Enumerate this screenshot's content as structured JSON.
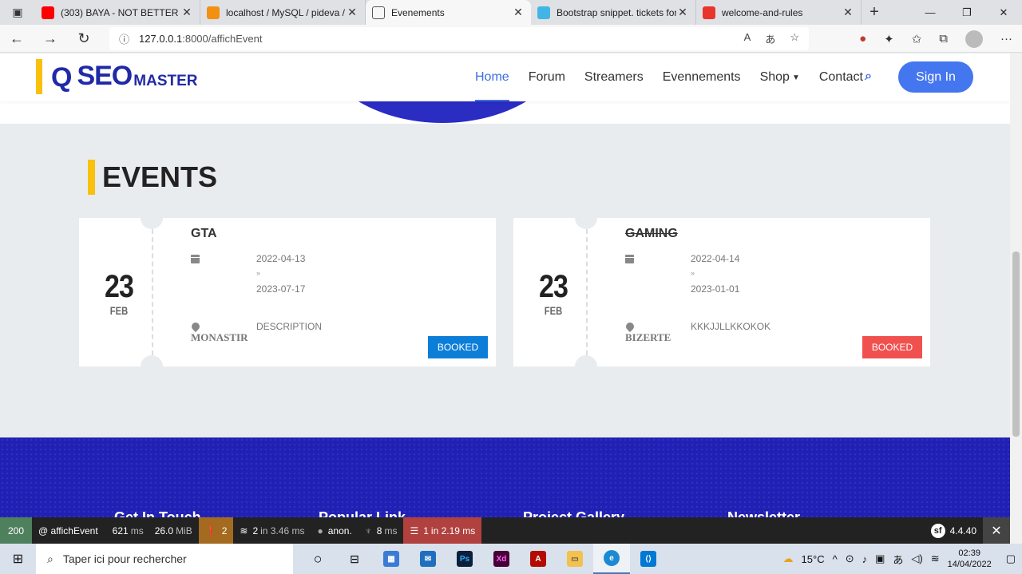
{
  "browser": {
    "tabs": [
      {
        "title": "(303) BAYA - NOT BETTER",
        "favicon": "youtube-icon",
        "color": "#ff0000",
        "active": false
      },
      {
        "title": "localhost / MySQL / pideva / events",
        "favicon": "phpmyadmin-icon",
        "color": "#f29111",
        "active": false
      },
      {
        "title": "Evenements",
        "favicon": "page-icon",
        "color": "#ffffff",
        "active": true
      },
      {
        "title": "Bootstrap snippet. tickets for events",
        "favicon": "bootdey-icon",
        "color": "#41b6e6",
        "active": false
      },
      {
        "title": "welcome-and-rules",
        "favicon": "discord-icon",
        "color": "#e8362d",
        "active": false
      }
    ],
    "url_host": "127.0.0.1",
    "url_path": ":8000/affichEvent"
  },
  "site": {
    "logo_main": "SEO",
    "logo_sub": "MASTER",
    "nav": [
      {
        "label": "Home",
        "active": true
      },
      {
        "label": "Forum",
        "active": false
      },
      {
        "label": "Streamers",
        "active": false
      },
      {
        "label": "Evennements",
        "active": false
      },
      {
        "label": "Shop",
        "active": false,
        "dropdown": true
      },
      {
        "label": "Contact",
        "active": false
      }
    ],
    "signin_label": "Sign In",
    "section_title": "EVENTS",
    "colors": {
      "accent": "#3d6ee0",
      "logo": "#202aa8",
      "brand_yellow": "#f9c00d",
      "footer": "#2020b5"
    }
  },
  "events": [
    {
      "day": "23",
      "month": "FEB",
      "name": "GTA",
      "strike": false,
      "date_start": "2022-04-13",
      "arrow": "»",
      "date_end": "2023-07-17",
      "city": "MONASTIR",
      "description": "DESCRIPTION",
      "button": "BOOKED",
      "button_color": "#0d7ed8"
    },
    {
      "day": "23",
      "month": "FEB",
      "name": "GAMING",
      "strike": true,
      "date_start": "2022-04-14",
      "arrow": "»",
      "date_end": "2023-01-01",
      "city": "BIZERTE",
      "description": "KKKJJLLKKOKOK",
      "button": "BOOKED",
      "button_color": "#f0514f"
    }
  ],
  "footer": {
    "headings": [
      "Get In Touch",
      "Popular Link",
      "Project Gallery",
      "Newsletter"
    ]
  },
  "symfony_toolbar": {
    "status": "200",
    "route": "@ affichEvent",
    "time": "621",
    "time_unit": "ms",
    "memory": "26.0",
    "memory_unit": "MiB",
    "warnings": "2",
    "cache": "2",
    "cache_detail": "in 3.46 ms",
    "user": "anon.",
    "twig": "8",
    "twig_unit": "ms",
    "db": "1",
    "db_detail": "in 2.19 ms",
    "version": "4.4.40"
  },
  "taskbar": {
    "search_placeholder": "Taper ici pour rechercher",
    "temperature": "15°C",
    "time": "02:39",
    "date": "14/04/2022"
  }
}
